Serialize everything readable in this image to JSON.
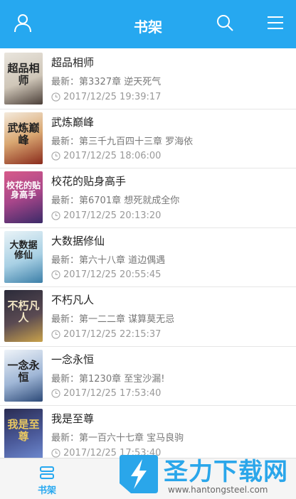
{
  "header": {
    "title": "书架",
    "icons": [
      "user-icon",
      "search-icon",
      "menu-icon"
    ]
  },
  "books": [
    {
      "title": "超品相师",
      "latest": "最新：第3327章 逆天死气",
      "time": "2017/12/25 19:39:17",
      "cover_text": "超品相师",
      "cover_colors": [
        "#e9e5dd",
        "#4b3f38"
      ]
    },
    {
      "title": "武炼巅峰",
      "latest": "最新：第三千九百四十三章 罗海依",
      "time": "2017/12/25 18:06:00",
      "cover_text": "武炼巅峰",
      "cover_colors": [
        "#f4eadc",
        "#8a2b1c"
      ]
    },
    {
      "title": "校花的贴身高手",
      "latest": "最新：第6701章 想死就成全你",
      "time": "2017/12/25 20:13:20",
      "cover_text": "校花的贴身高手",
      "cover_colors": [
        "#d75b8a",
        "#3b2a68"
      ]
    },
    {
      "title": "大数据修仙",
      "latest": "最新：第六十八章 道边偶遇",
      "time": "2017/12/25 20:55:45",
      "cover_text": "大数据修仙",
      "cover_colors": [
        "#e9f3f7",
        "#3c7fa8"
      ]
    },
    {
      "title": "不朽凡人",
      "latest": "最新：第一二二章 谋算莫无忌",
      "time": "2017/12/25 22:15:37",
      "cover_text": "不朽凡人",
      "cover_colors": [
        "#2b2b3a",
        "#c9a24b"
      ]
    },
    {
      "title": "一念永恒",
      "latest": "最新：第1230章 至宝沙漏!",
      "time": "2017/12/25 17:53:40",
      "cover_text": "一念永恒",
      "cover_colors": [
        "#eef3f8",
        "#2d4a78"
      ]
    },
    {
      "title": "我是至尊",
      "latest": "最新：第一百六十七章 宝马良驹",
      "time": "2017/12/25 17:53:40",
      "cover_text": "我是至尊",
      "cover_colors": [
        "#2a2c52",
        "#6f8bd1"
      ]
    }
  ],
  "bottom_nav": {
    "shelf_label": "书架"
  },
  "watermark": {
    "text": "圣力下载网",
    "url": "www.hantongsteel.com"
  },
  "colors": {
    "accent": "#26a8f0"
  }
}
